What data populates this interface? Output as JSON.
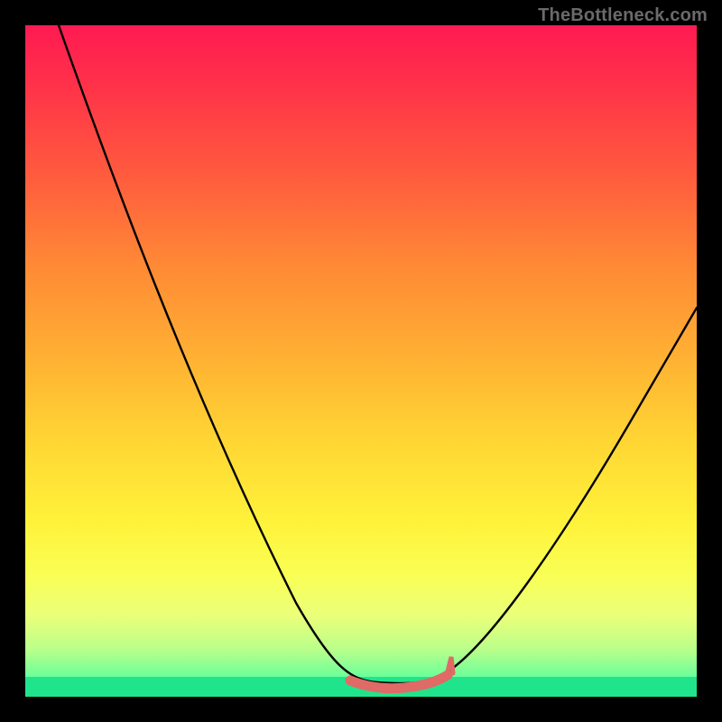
{
  "watermark": {
    "text": "TheBottleneck.com"
  },
  "colors": {
    "background": "#000000",
    "watermark": "#6a6a6a",
    "curve": "#000000",
    "valley_marker": "#e06a66",
    "gradient_top": "#ff1a52",
    "gradient_bottom": "#24e88f"
  },
  "chart_data": {
    "type": "line",
    "title": "",
    "xlabel": "",
    "ylabel": "",
    "xlim": [
      0,
      100
    ],
    "ylim": [
      0,
      100
    ],
    "grid": false,
    "legend": false,
    "series": [
      {
        "name": "bottleneck-curve",
        "x": [
          5,
          10,
          15,
          20,
          25,
          30,
          35,
          40,
          45,
          48,
          50,
          52,
          55,
          58,
          60,
          63,
          65,
          70,
          75,
          80,
          85,
          90,
          95,
          100
        ],
        "values": [
          100,
          90,
          80,
          70,
          60,
          50,
          40,
          30,
          20,
          12,
          6,
          3,
          2,
          2,
          3,
          5,
          9,
          17,
          25,
          33,
          40,
          47,
          53,
          58
        ]
      }
    ],
    "annotations": [
      {
        "type": "valley-band",
        "x_start": 50,
        "x_end": 63,
        "y": 2
      }
    ]
  }
}
